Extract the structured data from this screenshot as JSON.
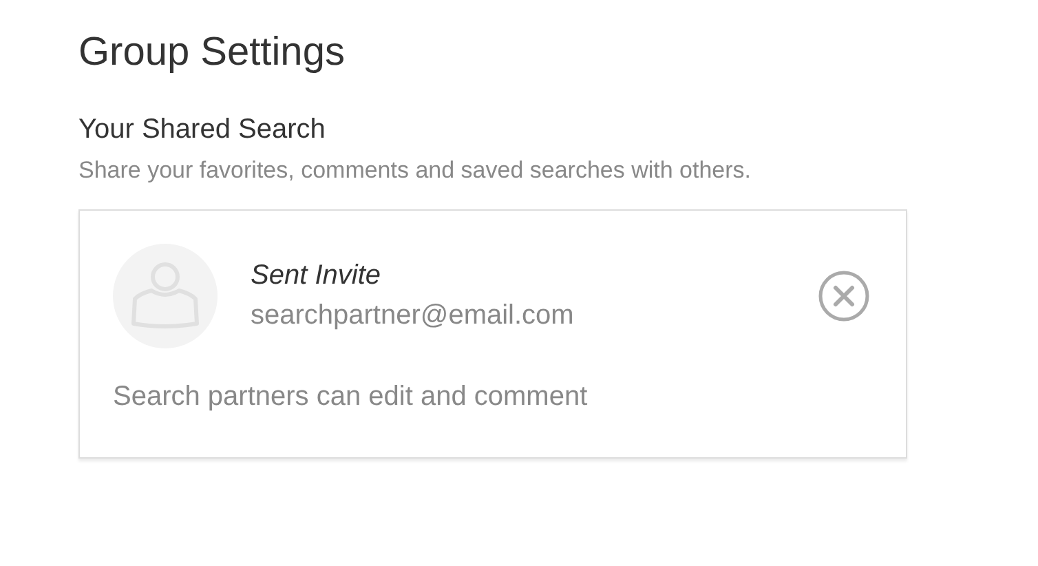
{
  "page": {
    "title": "Group Settings"
  },
  "section": {
    "heading": "Your Shared Search",
    "description": "Share your favorites, comments and saved searches with others."
  },
  "invite": {
    "status": "Sent Invite",
    "email": "searchpartner@email.com",
    "note": "Search partners can edit and comment"
  }
}
